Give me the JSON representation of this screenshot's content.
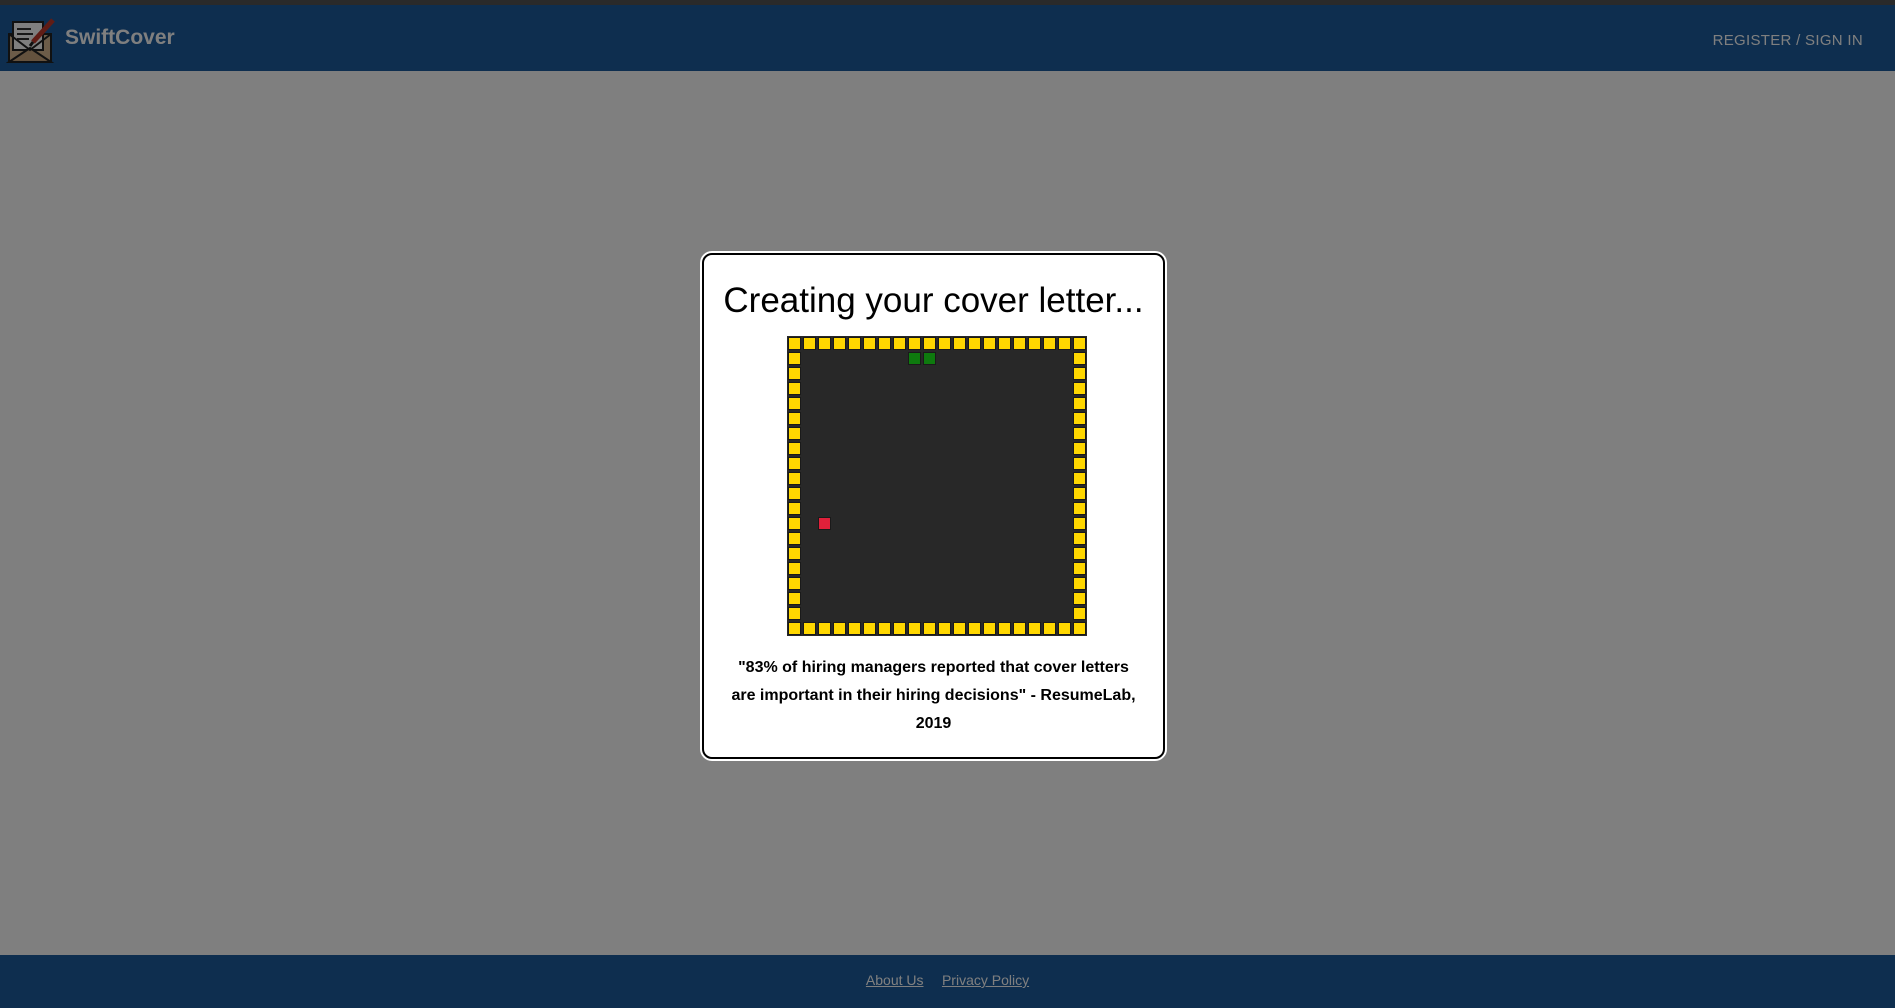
{
  "header": {
    "brand": "SwiftCover",
    "auth_link": "REGISTER / SIGN IN",
    "logo_icon": "envelope-pen-icon"
  },
  "modal": {
    "title": "Creating your cover letter...",
    "quote": "\"83% of hiring managers reported that cover letters are important in their hiring decisions\" - ResumeLab, 2019"
  },
  "game": {
    "grid_size": 20,
    "snake": [
      [
        8,
        1
      ],
      [
        9,
        1
      ]
    ],
    "food": [
      2,
      12
    ],
    "colors": {
      "wall": "#ffd700",
      "board": "#282828",
      "snake": "#0e7a0e",
      "food": "#e0203a"
    }
  },
  "footer": {
    "links": [
      {
        "label": "About Us"
      },
      {
        "label": "Privacy Policy"
      }
    ]
  },
  "colors": {
    "navbar": "#1c5d9f",
    "overlay": "rgba(0,0,0,0.5)"
  }
}
